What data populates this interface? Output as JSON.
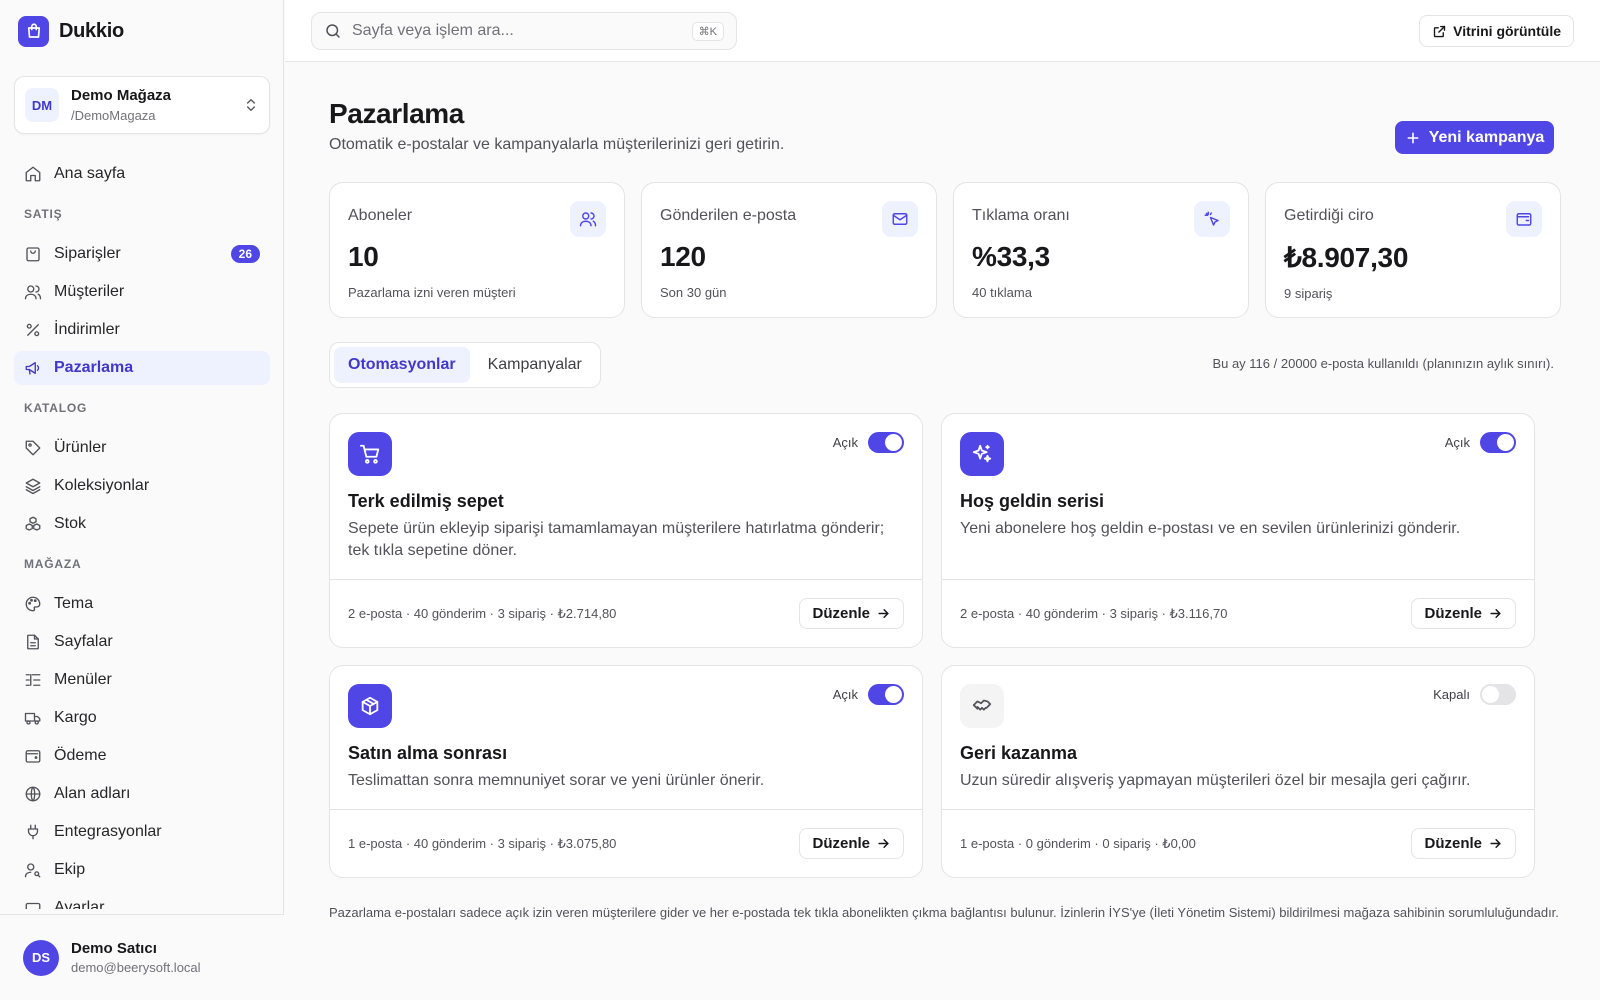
{
  "brand": {
    "name": "Dukkio"
  },
  "store": {
    "initials": "DM",
    "name": "Demo Mağaza",
    "handle": "/DemoMagaza"
  },
  "sidebar": {
    "home": "Ana sayfa",
    "sections": {
      "sales": "SATIŞ",
      "catalog": "KATALOG",
      "store": "MAĞAZA"
    },
    "items": {
      "orders": "Siparişler",
      "orders_badge": "26",
      "customers": "Müşteriler",
      "discounts": "İndirimler",
      "marketing": "Pazarlama",
      "products": "Ürünler",
      "collections": "Koleksiyonlar",
      "stock": "Stok",
      "theme": "Tema",
      "pages": "Sayfalar",
      "menus": "Menüler",
      "shipping": "Kargo",
      "payment": "Ödeme",
      "domains": "Alan adları",
      "integrations": "Entegrasyonlar",
      "team": "Ekip",
      "settings": "Ayarlar"
    }
  },
  "user": {
    "initials": "DS",
    "name": "Demo Satıcı",
    "email": "demo@beerysoft.local"
  },
  "topbar": {
    "search_placeholder": "Sayfa veya işlem ara...",
    "search_shortcut": "⌘K",
    "view_store": "Vitrini görüntüle"
  },
  "page": {
    "title": "Pazarlama",
    "subtitle": "Otomatik e-postalar ve kampanyalarla müşterilerinizi geri getirin.",
    "new_campaign": "Yeni kampanya"
  },
  "stats": [
    {
      "label": "Aboneler",
      "value": "10",
      "note": "Pazarlama izni veren müşteri",
      "icon": "users-icon"
    },
    {
      "label": "Gönderilen e-posta",
      "value": "120",
      "note": "Son 30 gün",
      "icon": "mail-icon"
    },
    {
      "label": "Tıklama oranı",
      "value": "%33,3",
      "note": "40 tıklama",
      "icon": "click-icon"
    },
    {
      "label": "Getirdiği ciro",
      "value": "₺8.907,30",
      "note": "9 sipariş",
      "icon": "wallet-icon"
    }
  ],
  "tabs": {
    "automations": "Otomasyonlar",
    "campaigns": "Kampanyalar"
  },
  "quota": "Bu ay 116 / 20000 e-posta kullanıldı (planınızın aylık sınırı).",
  "automations": [
    {
      "title": "Terk edilmiş sepet",
      "description": "Sepete ürün ekleyip siparişi tamamlamayan müşterilere hatırlatma gönderir; tek tıkla sepetine döner.",
      "status": "Açık",
      "enabled": true,
      "stats": "2 e-posta · 40 gönderim · 3 sipariş · ₺2.714,80",
      "edit": "Düzenle"
    },
    {
      "title": "Hoş geldin serisi",
      "description": "Yeni abonelere hoş geldin e-postası ve en sevilen ürünlerinizi gönderir.",
      "status": "Açık",
      "enabled": true,
      "stats": "2 e-posta · 40 gönderim · 3 sipariş · ₺3.116,70",
      "edit": "Düzenle"
    },
    {
      "title": "Satın alma sonrası",
      "description": "Teslimattan sonra memnuniyet sorar ve yeni ürünler önerir.",
      "status": "Açık",
      "enabled": true,
      "stats": "1 e-posta · 40 gönderim · 3 sipariş · ₺3.075,80",
      "edit": "Düzenle"
    },
    {
      "title": "Geri kazanma",
      "description": "Uzun süredir alışveriş yapmayan müşterileri özel bir mesajla geri çağırır.",
      "status": "Kapalı",
      "enabled": false,
      "stats": "1 e-posta · 0 gönderim · 0 sipariş · ₺0,00",
      "edit": "Düzenle"
    }
  ],
  "footnote": "Pazarlama e-postaları sadece açık izin veren müşterilere gider ve her e-postada tek tıkla abonelikten çıkma bağlantısı bulunur. İzinlerin İYS'ye (İleti Yönetim Sistemi) bildirilmesi mağaza sahibinin sorumluluğundadır.",
  "colors": {
    "accent": "#4f46e5",
    "accent_soft": "#eef2ff",
    "border": "#e4e4e7"
  }
}
